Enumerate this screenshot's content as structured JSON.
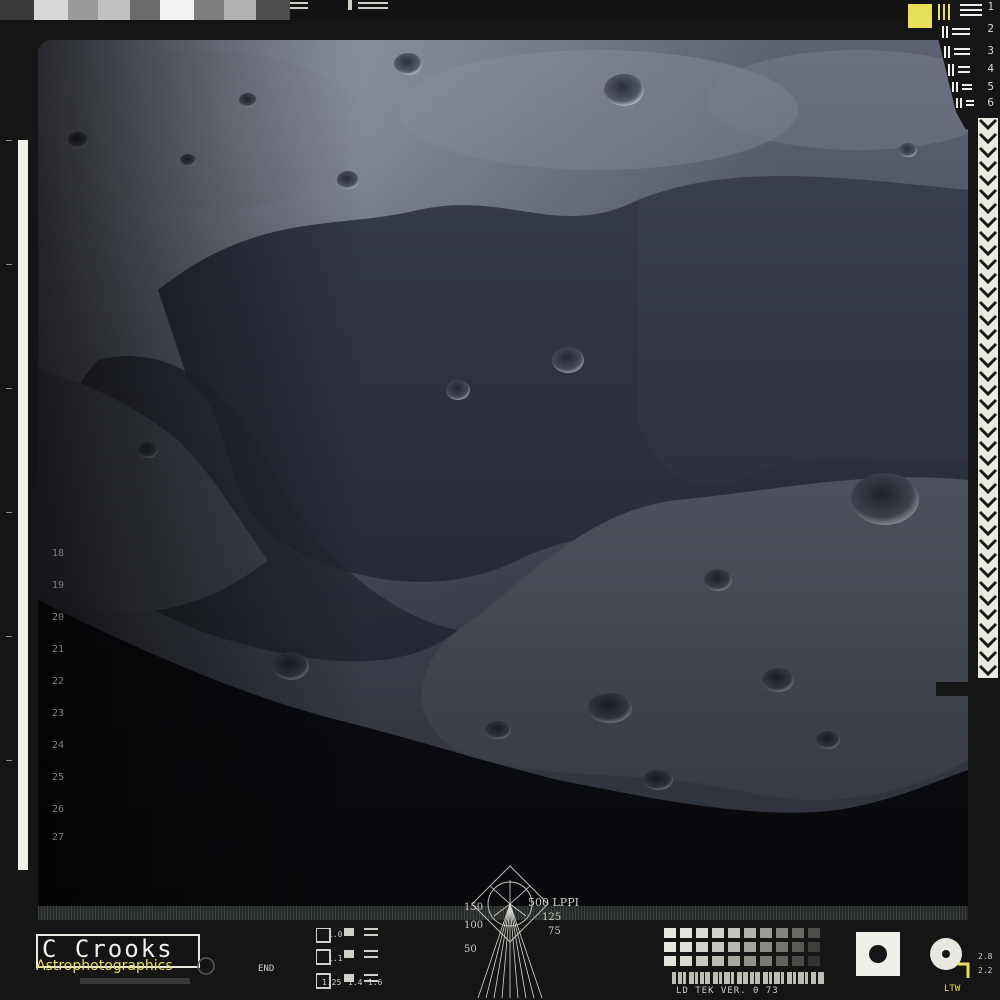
{
  "image": {
    "subject": "lunar-surface",
    "frame_style": "vintage film scan overlay"
  },
  "colors": {
    "frame": "#151515",
    "accent_yellow": "#e6df5a",
    "film_white": "#f0f0ea",
    "moon_dark": "#0b0c12"
  },
  "film_numbers": [
    "1",
    "2",
    "3",
    "4",
    "5",
    "6"
  ],
  "ruler_ticks": [
    "18",
    "19",
    "20",
    "21",
    "22",
    "23",
    "24",
    "25",
    "26",
    "27"
  ],
  "logo": {
    "title": "C Crooks",
    "subtitle": "Astrophotographics"
  },
  "lppi_target": {
    "unit": "500 LPPI",
    "labels": [
      "150",
      "100",
      "50",
      "125",
      "75"
    ]
  },
  "resolution_labels": [
    "1.0",
    "1.1",
    "1.25",
    "1.4",
    "1.6"
  ],
  "end_label": "END",
  "tek_label": "LD TEK VER. 0 73",
  "corner_label": "LTW",
  "corner_scale": [
    "2.2",
    "2.8"
  ]
}
